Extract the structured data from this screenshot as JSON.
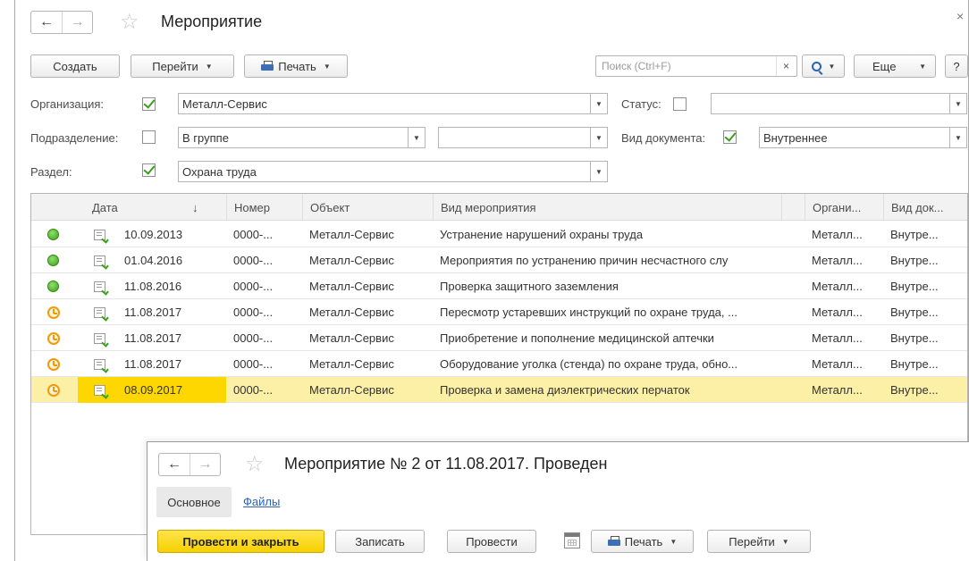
{
  "window": {
    "title": "Мероприятие",
    "close_glyph": "×",
    "back_glyph": "←",
    "forward_glyph": "→",
    "star_glyph": "☆"
  },
  "toolbar": {
    "create_label": "Создать",
    "goto_label": "Перейти",
    "print_label": "Печать",
    "search_placeholder": "Поиск (Ctrl+F)",
    "search_clear": "×",
    "more_label": "Еще",
    "help_label": "?"
  },
  "filters": {
    "organization": {
      "label": "Организация:",
      "checked": true,
      "value": "Металл-Сервис"
    },
    "status": {
      "label": "Статус:",
      "checked": false,
      "value": ""
    },
    "subdivision": {
      "label": "Подразделение:",
      "checked": false,
      "mode": "В группе",
      "value": ""
    },
    "doc_kind": {
      "label": "Вид документа:",
      "checked": true,
      "value": "Внутреннее"
    },
    "section": {
      "label": "Раздел:",
      "checked": true,
      "value": "Охрана труда"
    }
  },
  "table": {
    "columns": [
      "Дата",
      "↓",
      "Номер",
      "Объект",
      "Вид мероприятия",
      "Органи...",
      "Вид док..."
    ],
    "rows": [
      {
        "status": "green",
        "date": "10.09.2013",
        "number": "0000-...",
        "object": "Металл-Сервис",
        "kind": "Устранение нарушений охраны труда",
        "org": "Металл...",
        "doc": "Внутре..."
      },
      {
        "status": "green",
        "date": "01.04.2016",
        "number": "0000-...",
        "object": "Металл-Сервис",
        "kind": "Мероприятия по устранению причин несчастного слу",
        "org": "Металл...",
        "doc": "Внутре..."
      },
      {
        "status": "green",
        "date": "11.08.2016",
        "number": "0000-...",
        "object": "Металл-Сервис",
        "kind": "Проверка защитного заземления",
        "org": "Металл...",
        "doc": "Внутре..."
      },
      {
        "status": "orange",
        "date": "11.08.2017",
        "number": "0000-...",
        "object": "Металл-Сервис",
        "kind": "Пересмотр устаревших инструкций по охране труда, ...",
        "org": "Металл...",
        "doc": "Внутре..."
      },
      {
        "status": "orange",
        "date": "11.08.2017",
        "number": "0000-...",
        "object": "Металл-Сервис",
        "kind": "Приобретение и пополнение медицинской аптечки",
        "org": "Металл...",
        "doc": "Внутре..."
      },
      {
        "status": "orange",
        "date": "11.08.2017",
        "number": "0000-...",
        "object": "Металл-Сервис",
        "kind": "Оборудование уголка (стенда) по охране труда, обно...",
        "org": "Металл...",
        "doc": "Внутре..."
      },
      {
        "status": "orange",
        "date": "08.09.2017",
        "number": "0000-...",
        "object": "Металл-Сервис",
        "kind": "Проверка и замена диэлектрических перчаток",
        "org": "Металл...",
        "doc": "Внутре..."
      }
    ]
  },
  "subwindow": {
    "title": "Мероприятие № 2 от 11.08.2017. Проведен",
    "tab_main": "Основное",
    "tab_files": "Файлы",
    "post_close_label": "Провести и закрыть",
    "save_label": "Записать",
    "post_label": "Провести",
    "print_label": "Печать",
    "goto_label": "Перейти"
  },
  "colors": {
    "accent_yellow": "#f7d000",
    "selected_row": "#fcefa6",
    "link_blue": "#2a64b3",
    "status_green": "#3ea01c",
    "status_orange": "#f09a0a"
  }
}
